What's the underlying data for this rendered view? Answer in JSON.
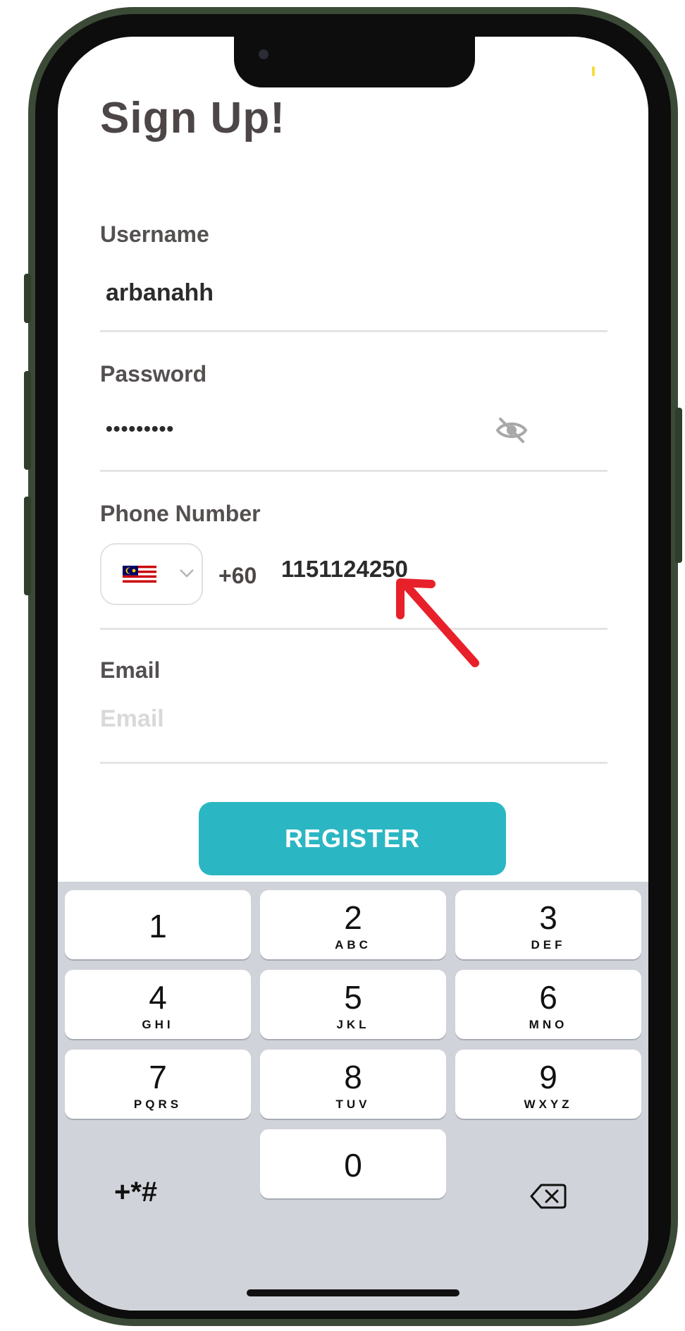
{
  "title": "Sign Up!",
  "form": {
    "username": {
      "label": "Username",
      "value": "arbanahh"
    },
    "password": {
      "label": "Password",
      "value": "•••••••••"
    },
    "phone": {
      "label": "Phone Number",
      "country_code": "+60",
      "value": "1151124250"
    },
    "email": {
      "label": "Email",
      "placeholder": "Email"
    },
    "register_label": "REGISTER"
  },
  "keypad": {
    "keys": [
      {
        "num": "1",
        "letters": ""
      },
      {
        "num": "2",
        "letters": "ABC"
      },
      {
        "num": "3",
        "letters": "DEF"
      },
      {
        "num": "4",
        "letters": "GHI"
      },
      {
        "num": "5",
        "letters": "JKL"
      },
      {
        "num": "6",
        "letters": "MNO"
      },
      {
        "num": "7",
        "letters": "PQRS"
      },
      {
        "num": "8",
        "letters": "TUV"
      },
      {
        "num": "9",
        "letters": "WXYZ"
      },
      {
        "num": "0",
        "letters": ""
      }
    ],
    "symbols": "+*#"
  },
  "colors": {
    "accent": "#2bb6c3",
    "annotation_arrow": "#e8202a"
  },
  "icons": [
    "eye-off-icon",
    "malaysia-flag-icon",
    "chevron-down-icon",
    "backspace-icon",
    "red-arrow-annotation"
  ]
}
